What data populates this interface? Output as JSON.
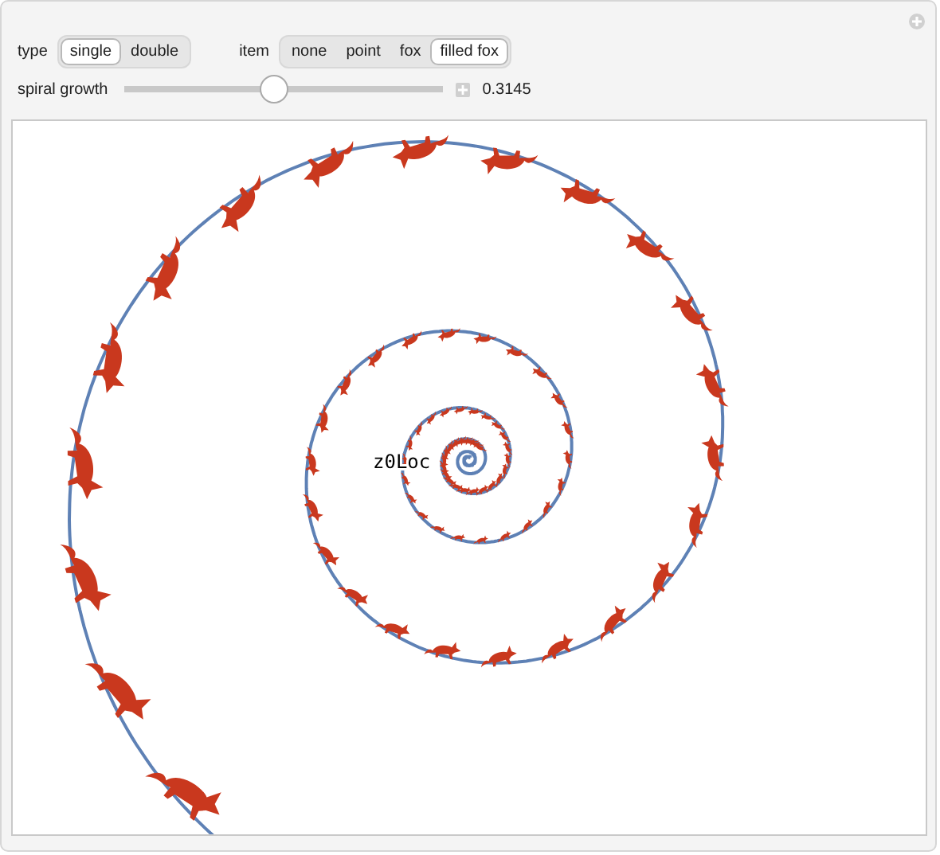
{
  "controls": {
    "type": {
      "label": "type",
      "options": [
        {
          "label": "single",
          "selected": true
        },
        {
          "label": "double",
          "selected": false
        }
      ]
    },
    "item": {
      "label": "item",
      "options": [
        {
          "label": "none",
          "selected": false
        },
        {
          "label": "point",
          "selected": false
        },
        {
          "label": "fox",
          "selected": false
        },
        {
          "label": "filled fox",
          "selected": true
        }
      ]
    },
    "spiral_growth": {
      "label": "spiral growth",
      "level": 0.47,
      "reading": "0.3145"
    }
  },
  "plot": {
    "annotation": "z0Loc"
  }
}
